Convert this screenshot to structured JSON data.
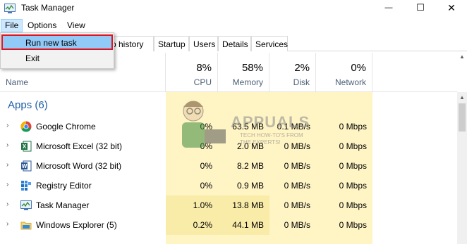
{
  "window": {
    "title": "Task Manager",
    "min_glyph": "—",
    "max_glyph": "☐",
    "close_glyph": "✕"
  },
  "menu": {
    "file": "File",
    "options": "Options",
    "view": "View"
  },
  "file_menu": {
    "items": [
      "Run new task",
      "Exit"
    ],
    "highlighted": "Run new task"
  },
  "tabs": {
    "partial": "p history",
    "startup": "Startup",
    "users": "Users",
    "details": "Details",
    "services": "Services"
  },
  "columns": {
    "name": "Name",
    "cpu": {
      "pct": "8%",
      "label": "CPU"
    },
    "memory": {
      "pct": "58%",
      "label": "Memory"
    },
    "disk": {
      "pct": "2%",
      "label": "Disk"
    },
    "network": {
      "pct": "0%",
      "label": "Network"
    }
  },
  "group": {
    "title": "Apps (6)"
  },
  "rows": [
    {
      "name": "Google Chrome",
      "icon": "chrome-icon",
      "cpu": "0%",
      "mem": "63.5 MB",
      "disk": "0.1 MB/s",
      "net": "0 Mbps"
    },
    {
      "name": "Microsoft Excel (32 bit)",
      "icon": "excel-icon",
      "cpu": "0%",
      "mem": "2.0 MB",
      "disk": "0 MB/s",
      "net": "0 Mbps"
    },
    {
      "name": "Microsoft Word (32 bit)",
      "icon": "word-icon",
      "cpu": "0%",
      "mem": "8.2 MB",
      "disk": "0 MB/s",
      "net": "0 Mbps"
    },
    {
      "name": "Registry Editor",
      "icon": "registry-icon",
      "cpu": "0%",
      "mem": "0.9 MB",
      "disk": "0 MB/s",
      "net": "0 Mbps"
    },
    {
      "name": "Task Manager",
      "icon": "task-manager-icon",
      "cpu": "1.0%",
      "mem": "13.8 MB",
      "disk": "0 MB/s",
      "net": "0 Mbps"
    },
    {
      "name": "Windows Explorer (5)",
      "icon": "folder-icon",
      "cpu": "0.2%",
      "mem": "44.1 MB",
      "disk": "0 MB/s",
      "net": "0 Mbps"
    }
  ],
  "watermark": {
    "brand": "APPUALS",
    "tagline": "TECH HOW-TO'S FROM THE EXPERTS!"
  },
  "colors": {
    "heat": "#fff4c4",
    "heat_hot": "#f9eca8",
    "menu_highlight": "#91c9f7",
    "highlight_border": "#e0141e",
    "group_title": "#1f5fa8"
  }
}
